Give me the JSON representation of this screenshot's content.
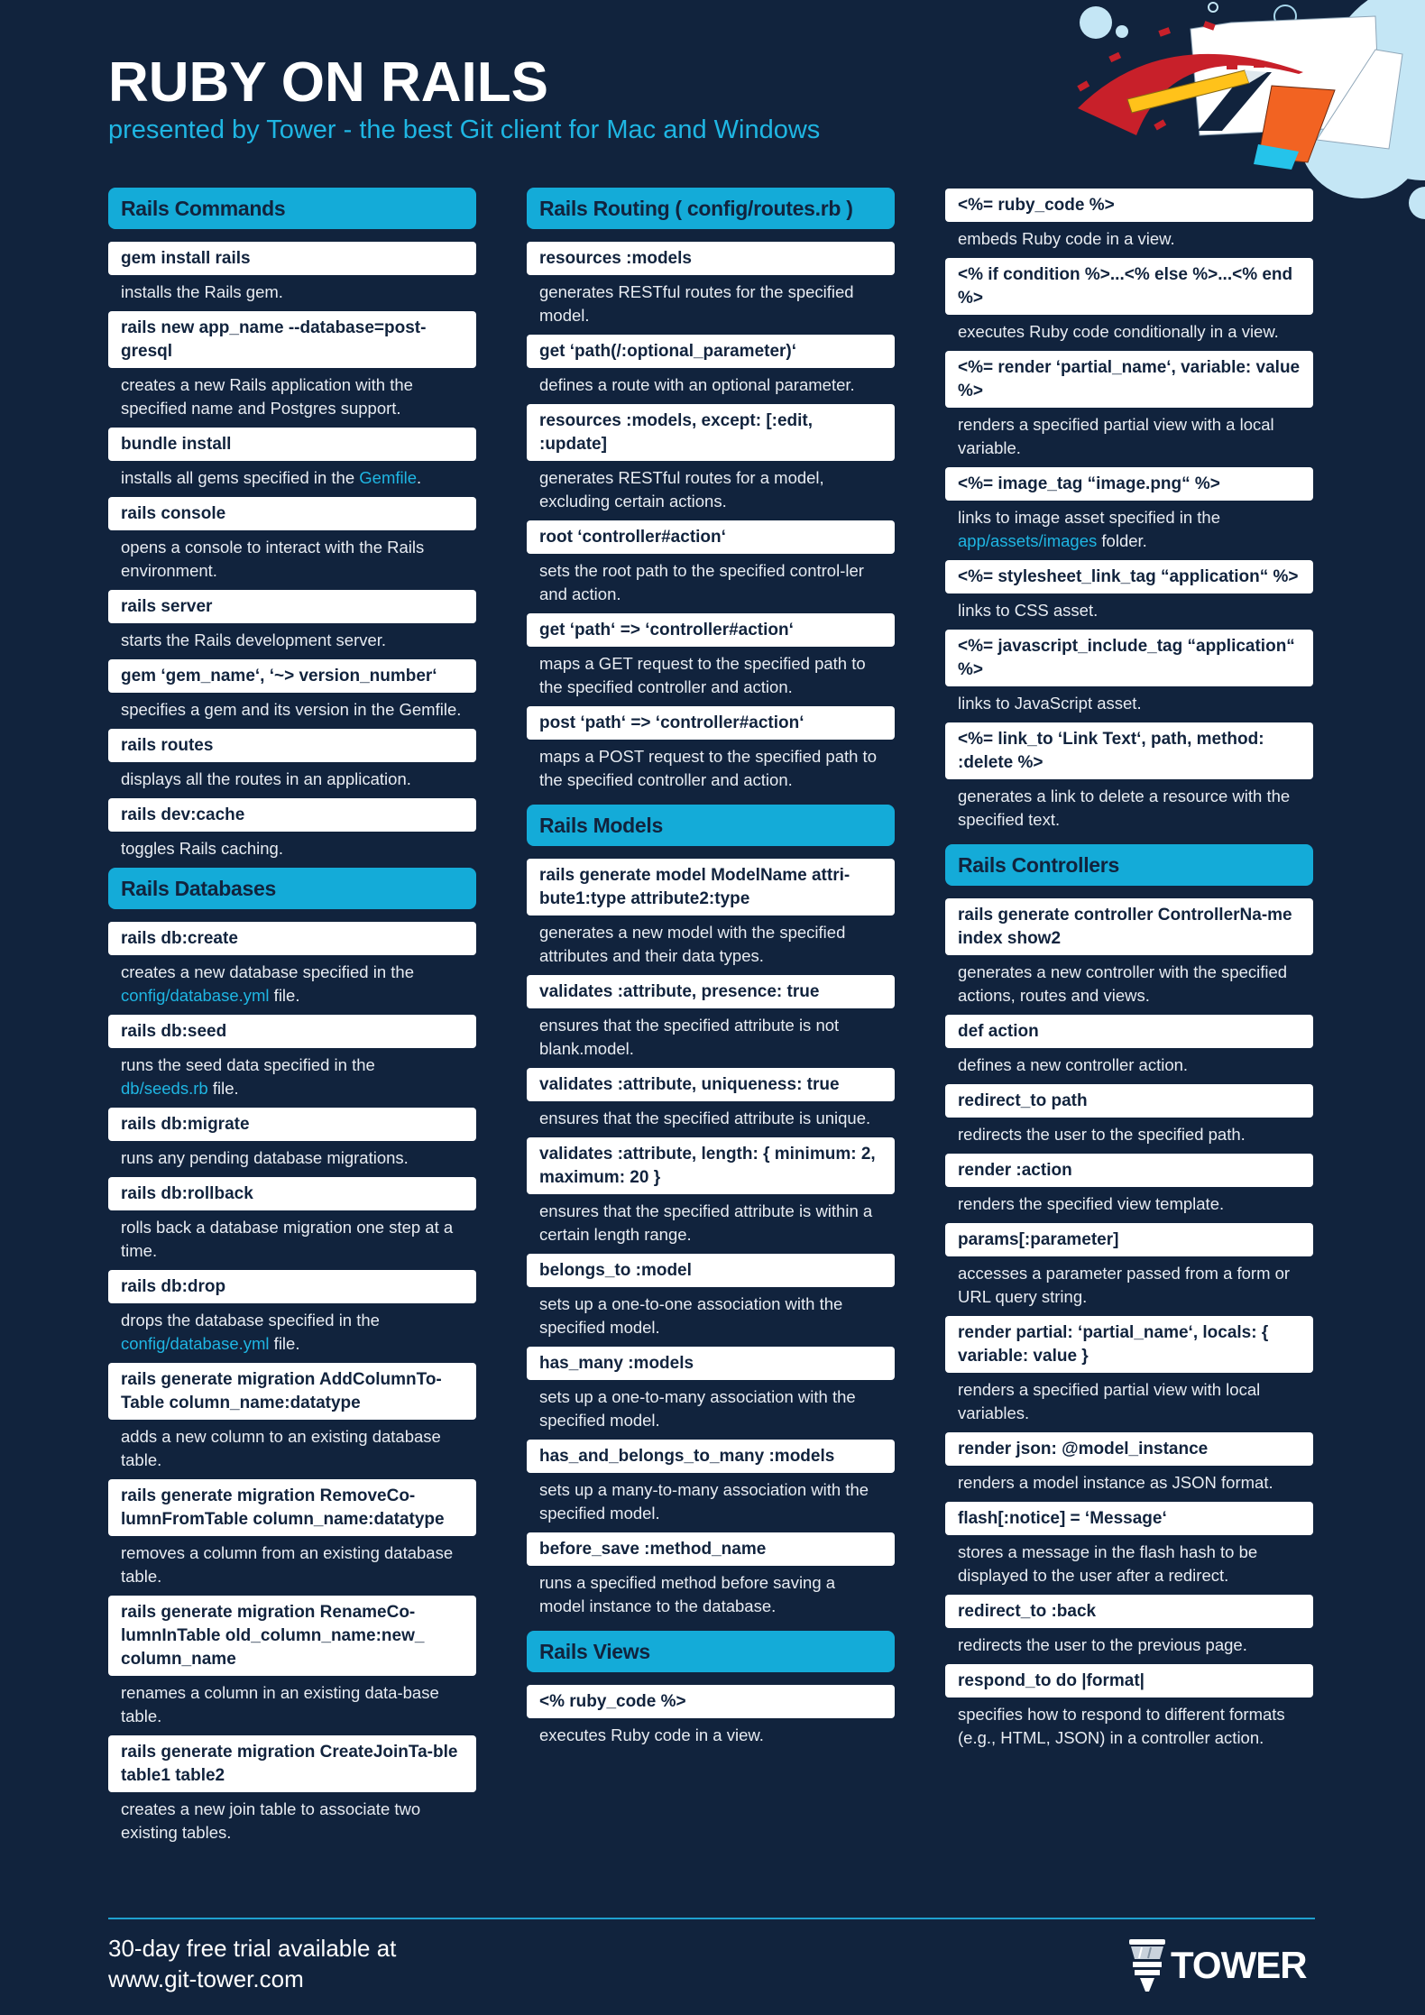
{
  "header": {
    "title": "RUBY ON RAILS",
    "subtitle": "presented by Tower - the best Git client for Mac and Windows"
  },
  "colors": {
    "background": "#11233d",
    "accent": "#14abd8",
    "link": "#1fb6e3",
    "code_bg": "#ffffff"
  },
  "columns": [
    {
      "sections": [
        {
          "title": "Rails Commands",
          "entries": [
            {
              "code": "gem install rails",
              "desc": [
                {
                  "t": "installs the Rails gem."
                }
              ]
            },
            {
              "code": "rails new app_name --database=post-gresql",
              "desc": [
                {
                  "t": "creates a new Rails application with the specified name and Postgres support."
                }
              ]
            },
            {
              "code": "bundle install",
              "desc": [
                {
                  "t": "installs all gems specified in the "
                },
                {
                  "t": "Gemfile",
                  "hl": true
                },
                {
                  "t": "."
                }
              ]
            },
            {
              "code": "rails console",
              "desc": [
                {
                  "t": "opens a console to interact with the Rails environment."
                }
              ]
            },
            {
              "code": "rails server",
              "desc": [
                {
                  "t": "starts the Rails development server."
                }
              ]
            },
            {
              "code": "gem ‘gem_name‘, ‘~> version_number‘",
              "desc": [
                {
                  "t": "specifies a gem and its version in the Gemfile."
                }
              ]
            },
            {
              "code": "rails routes",
              "desc": [
                {
                  "t": "displays all the routes in an application."
                }
              ]
            },
            {
              "code": "rails dev:cache",
              "desc": [
                {
                  "t": "toggles Rails caching."
                }
              ]
            }
          ]
        },
        {
          "title": "Rails Databases",
          "entries": [
            {
              "code": "rails db:create",
              "desc": [
                {
                  "t": "creates a new database specified in the "
                },
                {
                  "t": "config/database.yml",
                  "hl": true
                },
                {
                  "t": " file."
                }
              ]
            },
            {
              "code": "rails db:seed",
              "desc": [
                {
                  "t": "runs the seed data specified in the "
                },
                {
                  "t": "db/seeds.rb",
                  "hl": true
                },
                {
                  "t": " file."
                }
              ]
            },
            {
              "code": "rails db:migrate",
              "desc": [
                {
                  "t": "runs any pending database migrations."
                }
              ]
            },
            {
              "code": "rails db:rollback",
              "desc": [
                {
                  "t": "rolls back a database migration one step at a time."
                }
              ]
            },
            {
              "code": "rails db:drop",
              "desc": [
                {
                  "t": "drops the database specified in the "
                },
                {
                  "t": "config/database.yml",
                  "hl": true
                },
                {
                  "t": " file."
                }
              ]
            },
            {
              "code": "rails generate migration AddColumnTo-Table column_name:datatype",
              "desc": [
                {
                  "t": "adds a new column to an existing database table."
                }
              ]
            },
            {
              "code": "rails generate migration RemoveCo-lumnFromTable column_name:datatype",
              "desc": [
                {
                  "t": "removes a column from an existing database table."
                }
              ]
            },
            {
              "code": "rails generate migration RenameCo-lumnInTable old_column_name:new_ column_name",
              "desc": [
                {
                  "t": "renames a column in an existing data-base table."
                }
              ]
            },
            {
              "code": "rails generate migration CreateJoinTa-ble table1 table2",
              "desc": [
                {
                  "t": "creates a new join table to associate two existing tables."
                }
              ]
            }
          ]
        }
      ]
    },
    {
      "sections": [
        {
          "title": "Rails Routing ( config/routes.rb )",
          "entries": [
            {
              "code": "resources :models",
              "desc": [
                {
                  "t": "generates RESTful routes for the specified model."
                }
              ]
            },
            {
              "code": "get ‘path(/:optional_parameter)‘",
              "desc": [
                {
                  "t": "defines a route with an optional parameter."
                }
              ]
            },
            {
              "code": "resources :models, except: [:edit, :update]",
              "desc": [
                {
                  "t": "generates RESTful routes for a model, excluding certain actions."
                }
              ]
            },
            {
              "code": "root ‘controller#action‘",
              "desc": [
                {
                  "t": "sets the root path to the specified control-ler and action."
                }
              ]
            },
            {
              "code": "get ‘path‘ => ‘controller#action‘",
              "desc": [
                {
                  "t": "maps a GET request to the specified path to the specified controller and action."
                }
              ]
            },
            {
              "code": "post ‘path‘ => ‘controller#action‘",
              "desc": [
                {
                  "t": "maps a POST request to the specified path to the specified controller and action."
                }
              ]
            }
          ]
        },
        {
          "title": "Rails Models",
          "entries": [
            {
              "code": "rails generate model ModelName attri-bute1:type attribute2:type",
              "desc": [
                {
                  "t": "generates a new model with the specified attributes and their data types."
                }
              ]
            },
            {
              "code": "validates :attribute, presence: true",
              "desc": [
                {
                  "t": "ensures that the specified attribute is not blank.model."
                }
              ]
            },
            {
              "code": "validates :attribute, uniqueness: true",
              "desc": [
                {
                  "t": "ensures that the specified attribute is unique."
                }
              ]
            },
            {
              "code": "validates :attribute, length: { minimum: 2, maximum: 20 }",
              "desc": [
                {
                  "t": "ensures that the specified attribute is within a certain length range."
                }
              ]
            },
            {
              "code": "belongs_to :model",
              "desc": [
                {
                  "t": "sets up a one-to-one association with the specified model."
                }
              ]
            },
            {
              "code": "has_many :models",
              "desc": [
                {
                  "t": "sets up a one-to-many association with the specified model."
                }
              ]
            },
            {
              "code": "has_and_belongs_to_many :models",
              "desc": [
                {
                  "t": "sets up a many-to-many association with the specified model."
                }
              ]
            },
            {
              "code": "before_save :method_name",
              "desc": [
                {
                  "t": "runs a specified method before saving a model instance to the database."
                }
              ]
            }
          ]
        },
        {
          "title": "Rails Views",
          "entries": [
            {
              "code": "<% ruby_code %>",
              "desc": [
                {
                  "t": "executes Ruby code in a view."
                }
              ]
            }
          ]
        }
      ]
    },
    {
      "sections": [
        {
          "title": "",
          "entries": [
            {
              "code": "<%= ruby_code %>",
              "desc": [
                {
                  "t": "embeds Ruby code in a view."
                }
              ]
            },
            {
              "code": "<% if condition %>...<% else %>...<% end %>",
              "desc": [
                {
                  "t": "executes Ruby code conditionally in a view."
                }
              ]
            },
            {
              "code": "<%= render ‘partial_name‘, variable: value %>",
              "desc": [
                {
                  "t": "renders a specified partial view with a local variable."
                }
              ]
            },
            {
              "code": "<%= image_tag “image.png“ %>",
              "desc": [
                {
                  "t": "links to image asset specified in the "
                },
                {
                  "t": "app/assets/images",
                  "hl": true
                },
                {
                  "t": " folder."
                }
              ]
            },
            {
              "code": "<%= stylesheet_link_tag “application“ %>",
              "desc": [
                {
                  "t": "links to CSS asset."
                }
              ]
            },
            {
              "code": "<%= javascript_include_tag “application“ %>",
              "desc": [
                {
                  "t": "links to JavaScript asset."
                }
              ]
            },
            {
              "code": "<%= link_to ‘Link Text‘, path, method: :delete %>",
              "desc": [
                {
                  "t": "generates a link to delete a resource with the specified text."
                }
              ]
            }
          ]
        },
        {
          "title": "Rails Controllers",
          "entries": [
            {
              "code": "rails generate controller ControllerNa-me index show2",
              "desc": [
                {
                  "t": "generates a new controller with the specified actions, routes and views."
                }
              ]
            },
            {
              "code": "def action",
              "desc": [
                {
                  "t": "defines a new controller action."
                }
              ]
            },
            {
              "code": "redirect_to path",
              "desc": [
                {
                  "t": "redirects the user to the specified path."
                }
              ]
            },
            {
              "code": "render :action",
              "desc": [
                {
                  "t": "renders the specified view template."
                }
              ]
            },
            {
              "code": "params[:parameter]",
              "desc": [
                {
                  "t": "accesses a parameter passed from a form or URL query string."
                }
              ]
            },
            {
              "code": "render partial: ‘partial_name‘, locals: { variable: value }",
              "desc": [
                {
                  "t": "renders a specified partial view with local variables."
                }
              ]
            },
            {
              "code": "render json: @model_instance",
              "desc": [
                {
                  "t": "renders a model instance as JSON format."
                }
              ]
            },
            {
              "code": "flash[:notice] = ‘Message‘",
              "desc": [
                {
                  "t": "stores a message in the flash hash to be displayed to the user after a redirect."
                }
              ]
            },
            {
              "code": "redirect_to :back",
              "desc": [
                {
                  "t": "redirects the user to the previous page."
                }
              ]
            },
            {
              "code": "respond_to do |format|",
              "desc": [
                {
                  "t": "specifies how to respond to different formats (e.g., HTML, JSON) in a controller action."
                }
              ]
            }
          ]
        }
      ]
    }
  ],
  "footer": {
    "line1": "30-day free trial available at",
    "line2": "www.git-tower.com",
    "logo_text": "TOWER"
  }
}
